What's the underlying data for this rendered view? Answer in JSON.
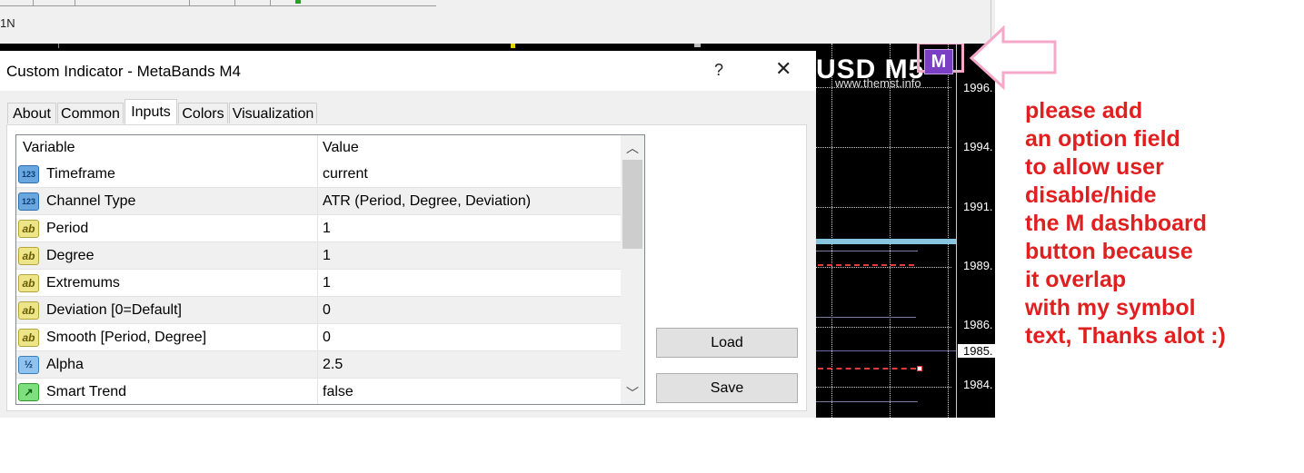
{
  "toolbar": {
    "timeframe_fragment": "1N"
  },
  "chart": {
    "symbol_text": "USD M5",
    "website": "www.themst.info",
    "m_button_label": "M",
    "price_labels": [
      "1996.",
      "1994.",
      "1991.",
      "1989.",
      "1986.",
      "1985.",
      "1984."
    ],
    "highlighted_price": "1985.",
    "colors": {
      "band": "#87c5df",
      "signal": "#e03a3a",
      "m_button": "#7b3fc4"
    }
  },
  "dialog": {
    "title": "Custom Indicator - MetaBands M4",
    "help_label": "?",
    "close_label": "✕",
    "tabs": [
      "About",
      "Common",
      "Inputs",
      "Colors",
      "Visualization"
    ],
    "active_tab": "Inputs",
    "table": {
      "columns": [
        "Variable",
        "Value"
      ],
      "rows": [
        {
          "icon": "123-icon",
          "icon_text": "123",
          "variable": "Timeframe",
          "value": "current"
        },
        {
          "icon": "123-icon",
          "icon_text": "123",
          "variable": "Channel Type",
          "value": "ATR (Period, Degree, Deviation)"
        },
        {
          "icon": "ab-icon",
          "icon_text": "ab",
          "variable": "Period",
          "value": "1"
        },
        {
          "icon": "ab-icon",
          "icon_text": "ab",
          "variable": "Degree",
          "value": "1"
        },
        {
          "icon": "ab-icon",
          "icon_text": "ab",
          "variable": "Extremums",
          "value": "1"
        },
        {
          "icon": "ab-icon",
          "icon_text": "ab",
          "variable": "Deviation [0=Default]",
          "value": "0"
        },
        {
          "icon": "ab-icon",
          "icon_text": "ab",
          "variable": "Smooth [Period, Degree]",
          "value": "0"
        },
        {
          "icon": "fraction-icon",
          "icon_text": "½",
          "variable": "Alpha",
          "value": "2.5"
        },
        {
          "icon": "trend-icon",
          "icon_text": "↗",
          "variable": "Smart Trend",
          "value": "false"
        }
      ]
    },
    "load_label": "Load",
    "save_label": "Save"
  },
  "annotation": {
    "lines": [
      "please add",
      "an option field",
      "to allow user",
      "disable/hide",
      "the M dashboard",
      "button because",
      "it overlap",
      "with my symbol",
      "text, Thanks alot :)"
    ],
    "color": "#e02020",
    "arrow_color": "#f5a8c8"
  }
}
